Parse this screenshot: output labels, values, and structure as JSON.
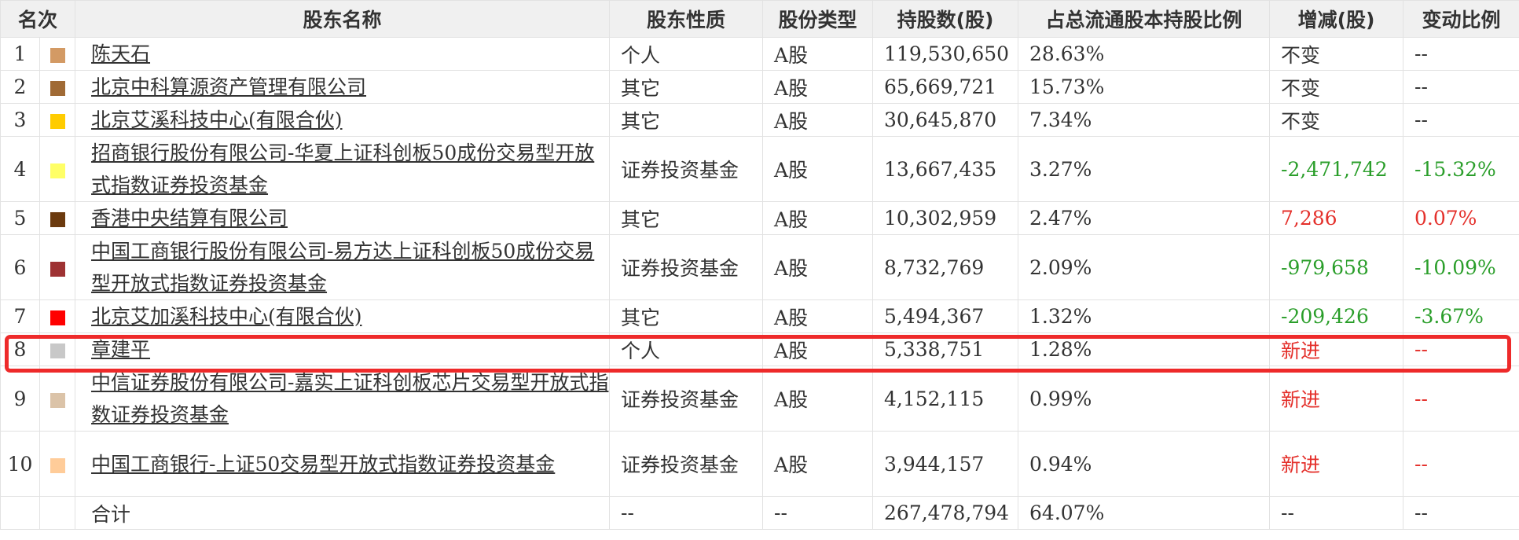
{
  "table": {
    "headers": [
      "名次",
      "",
      "股东名称",
      "股东性质",
      "股份类型",
      "持股数(股)",
      "占总流通股本持股比例",
      "增减(股)",
      "变动比例"
    ],
    "rows": [
      {
        "rank": "1",
        "swatch": "#d39a64",
        "name": "陈天石",
        "nature": "个人",
        "type": "A股",
        "shares": "119,530,650",
        "ratio": "28.63%",
        "change": "不变",
        "change_pct": "--",
        "tone": "",
        "tall": false
      },
      {
        "rank": "2",
        "swatch": "#a06a35",
        "name": "北京中科算源资产管理有限公司",
        "nature": "其它",
        "type": "A股",
        "shares": "65,669,721",
        "ratio": "15.73%",
        "change": "不变",
        "change_pct": "--",
        "tone": "",
        "tall": false
      },
      {
        "rank": "3",
        "swatch": "#ffcc00",
        "name": "北京艾溪科技中心(有限合伙)",
        "nature": "其它",
        "type": "A股",
        "shares": "30,645,870",
        "ratio": "7.34%",
        "change": "不变",
        "change_pct": "--",
        "tone": "",
        "tall": false
      },
      {
        "rank": "4",
        "swatch": "#ffff66",
        "name": "招商银行股份有限公司-华夏上证科创板50成份交易型开放式指数证券投资基金",
        "nature": "证券投资基金",
        "type": "A股",
        "shares": "13,667,435",
        "ratio": "3.27%",
        "change": "-2,471,742",
        "change_pct": "-15.32%",
        "tone": "dn",
        "tall": true
      },
      {
        "rank": "5",
        "swatch": "#6b3a0e",
        "name": "香港中央结算有限公司",
        "nature": "其它",
        "type": "A股",
        "shares": "10,302,959",
        "ratio": "2.47%",
        "change": "7,286",
        "change_pct": "0.07%",
        "tone": "up",
        "tall": false
      },
      {
        "rank": "6",
        "swatch": "#9e3233",
        "name": "中国工商银行股份有限公司-易方达上证科创板50成份交易型开放式指数证券投资基金",
        "nature": "证券投资基金",
        "type": "A股",
        "shares": "8,732,769",
        "ratio": "2.09%",
        "change": "-979,658",
        "change_pct": "-10.09%",
        "tone": "dn",
        "tall": true
      },
      {
        "rank": "7",
        "swatch": "#ff0000",
        "name": "北京艾加溪科技中心(有限合伙)",
        "nature": "其它",
        "type": "A股",
        "shares": "5,494,367",
        "ratio": "1.32%",
        "change": "-209,426",
        "change_pct": "-3.67%",
        "tone": "dn",
        "tall": false
      },
      {
        "rank": "8",
        "swatch": "#c8c8c8",
        "name": "章建平",
        "nature": "个人",
        "type": "A股",
        "shares": "5,338,751",
        "ratio": "1.28%",
        "change": "新进",
        "change_pct": "--",
        "tone": "up",
        "tall": false
      },
      {
        "rank": "9",
        "swatch": "#dbc3a8",
        "name": "中信证券股份有限公司-嘉实上证科创板芯片交易型开放式指数证券投资基金",
        "nature": "证券投资基金",
        "type": "A股",
        "shares": "4,152,115",
        "ratio": "0.99%",
        "change": "新进",
        "change_pct": "--",
        "tone": "up",
        "tall": true
      },
      {
        "rank": "10",
        "swatch": "#ffcc99",
        "name": "中国工商银行-上证50交易型开放式指数证券投资基金",
        "nature": "证券投资基金",
        "type": "A股",
        "shares": "3,944,157",
        "ratio": "0.94%",
        "change": "新进",
        "change_pct": "--",
        "tone": "up",
        "tall": true
      }
    ],
    "total": {
      "label": "合计",
      "nature": "--",
      "type": "--",
      "shares": "267,478,794",
      "ratio": "64.07%",
      "change": "--",
      "change_pct": "--"
    }
  },
  "colors": {
    "header_bg": "#f0f0f0",
    "border": "#e2e2e2",
    "text": "#333333",
    "increase": "#e4302b",
    "decrease": "#2a9e2a",
    "highlight_frame": "#ee2a2a"
  }
}
